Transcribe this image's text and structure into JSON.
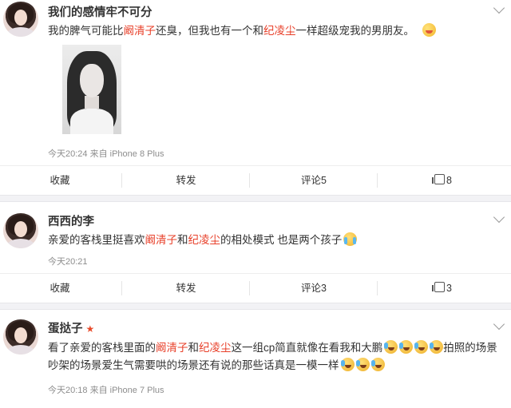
{
  "posts": [
    {
      "username": "我们的感情牢不可分",
      "text_parts": [
        "我的脾气可能比",
        "阚清子",
        "还臭，但我也有一个和",
        "纪凌尘",
        "一样超级宠我的男朋友。"
      ],
      "emoji": "blush-emoji",
      "meta": "今天20:24 来自 iPhone 8 Plus",
      "actions": {
        "favorite": "收藏",
        "repost": "转发",
        "comment": "评论5",
        "like": "8"
      }
    },
    {
      "username": "西西的李",
      "text_parts": [
        "亲爱的客栈里挺喜欢",
        "阚清子",
        "和",
        "纪凌尘",
        "的相处模式 也是两个孩子"
      ],
      "emoji": "cry-emoji",
      "meta": "今天20:21",
      "actions": {
        "favorite": "收藏",
        "repost": "转发",
        "comment": "评论3",
        "like": "3"
      }
    },
    {
      "username": "蛋挞子",
      "badge": "★",
      "text_parts": [
        "看了亲爱的客栈里面的",
        "阚清子",
        "和",
        "纪凌尘",
        "这一组cp简直就像在看我和大鹏",
        "拍照的场景吵架的场景爱生气需要哄的场景还有说的那些话真是一模一样"
      ],
      "emoji": "laugh-cry-emoji",
      "meta": "今天20:18 来自 iPhone 7 Plus"
    }
  ],
  "colors": {
    "highlight": "#e8402a",
    "meta": "#8d8d8d",
    "divider": "#f2f2f5"
  }
}
